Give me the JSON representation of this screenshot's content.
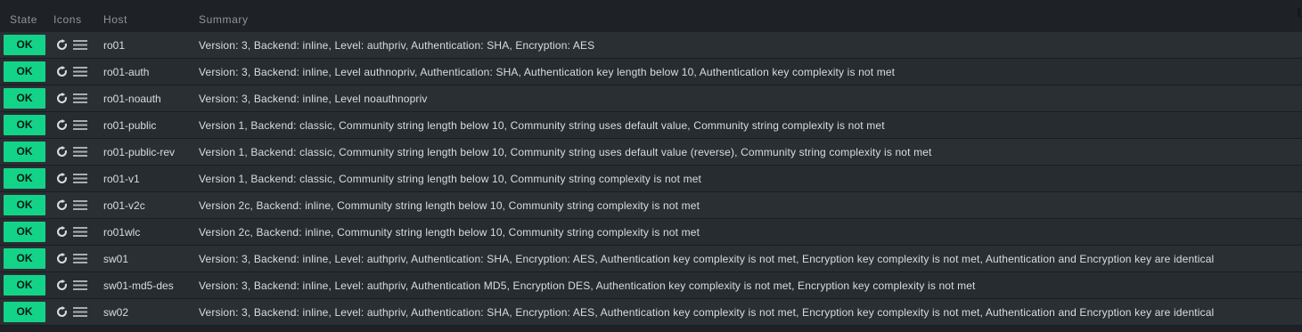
{
  "header": {
    "state": "State",
    "icons": "Icons",
    "host": "Host",
    "summary": "Summary"
  },
  "colors": {
    "ok": "#13d389",
    "background": "#1e2227",
    "row": "#2a2f34",
    "header_text": "#8f969c"
  },
  "icons": {
    "refresh": "refresh-icon",
    "menu": "menu-icon"
  },
  "rows": [
    {
      "state": "OK",
      "host": "ro01",
      "summary": "Version: 3, Backend: inline, Level: authpriv, Authentication: SHA, Encryption: AES"
    },
    {
      "state": "OK",
      "host": "ro01-auth",
      "summary": "Version: 3, Backend: inline, Level authnopriv, Authentication: SHA, Authentication key length below 10, Authentication key complexity is not met"
    },
    {
      "state": "OK",
      "host": "ro01-noauth",
      "summary": "Version: 3, Backend: inline, Level noauthnopriv"
    },
    {
      "state": "OK",
      "host": "ro01-public",
      "summary": "Version 1, Backend: classic, Community string length below 10, Community string uses default value, Community string complexity is not met"
    },
    {
      "state": "OK",
      "host": "ro01-public-rev",
      "summary": "Version 1, Backend: classic, Community string length below 10, Community string uses default value (reverse), Community string complexity is not met"
    },
    {
      "state": "OK",
      "host": "ro01-v1",
      "summary": "Version 1, Backend: classic, Community string length below 10, Community string complexity is not met"
    },
    {
      "state": "OK",
      "host": "ro01-v2c",
      "summary": "Version 2c, Backend: inline, Community string length below 10, Community string complexity is not met"
    },
    {
      "state": "OK",
      "host": "ro01wlc",
      "summary": "Version 2c, Backend: inline, Community string length below 10, Community string complexity is not met"
    },
    {
      "state": "OK",
      "host": "sw01",
      "summary": "Version: 3, Backend: inline, Level: authpriv, Authentication: SHA, Encryption: AES, Authentication key complexity is not met, Encryption key complexity is not met, Authentication and Encryption key are identical"
    },
    {
      "state": "OK",
      "host": "sw01-md5-des",
      "summary": "Version: 3, Backend: inline, Level: authpriv, Authentication MD5, Encryption DES, Authentication key complexity is not met, Encryption key complexity is not met"
    },
    {
      "state": "OK",
      "host": "sw02",
      "summary": "Version: 3, Backend: inline, Level: authpriv, Authentication: SHA, Encryption: AES, Authentication key complexity is not met, Encryption key complexity is not met, Authentication and Encryption key are identical"
    }
  ]
}
